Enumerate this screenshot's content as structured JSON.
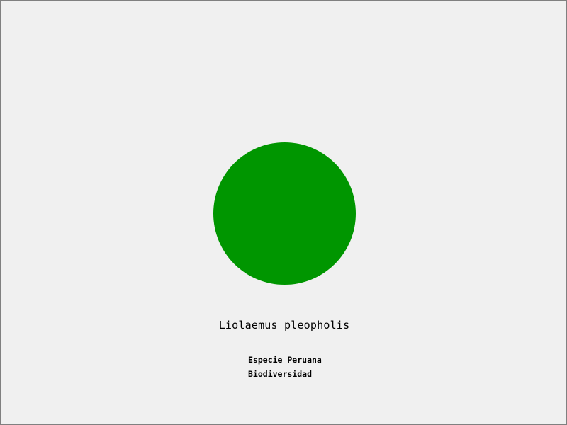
{
  "colors": {
    "background": "#f0f0f0",
    "circle": "#009600",
    "text": "#000000"
  },
  "shape": {
    "kind": "circle"
  },
  "species": {
    "name": "Liolaemus pleopholis"
  },
  "captions": [
    "Especie Peruana",
    "Biodiversidad"
  ]
}
